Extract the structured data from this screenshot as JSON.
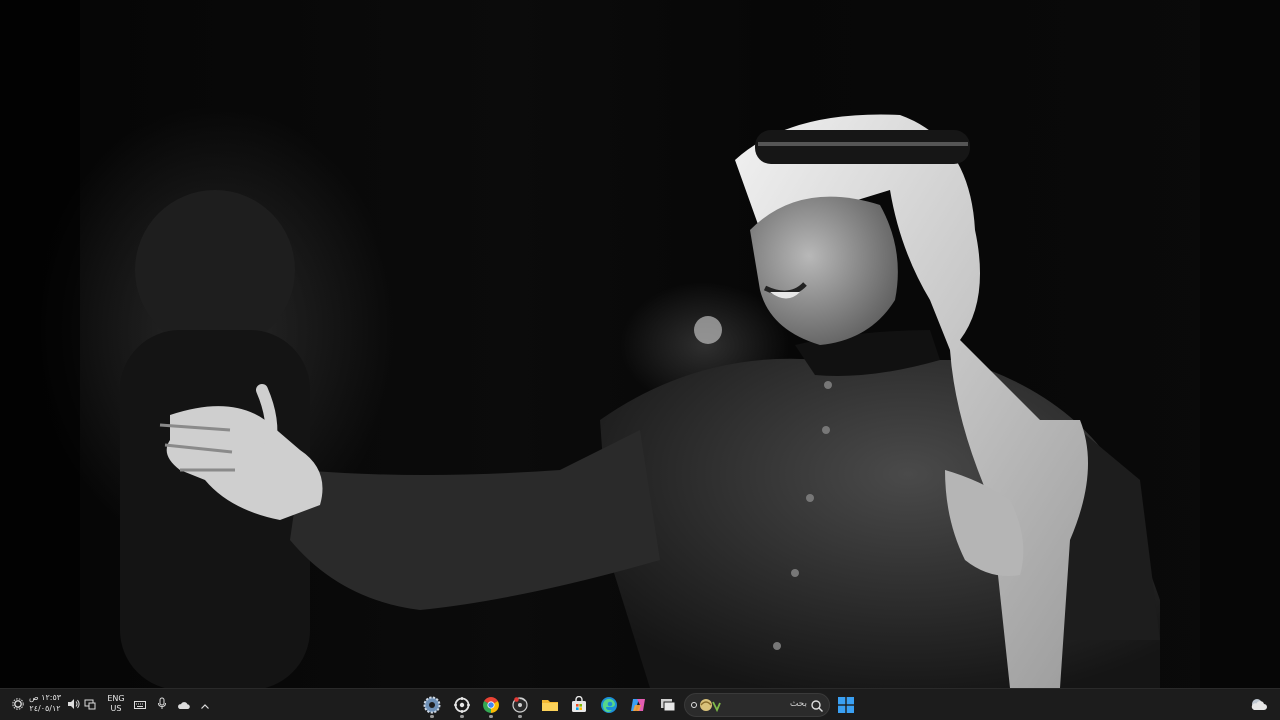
{
  "taskbar": {
    "clock": {
      "time": "١٢:٥٣ ص",
      "date": "٢٤/٠٥/١٢"
    },
    "language": {
      "line1": "ENG",
      "line2": "US"
    },
    "search": {
      "placeholder": "بحث"
    },
    "pinned_apps": [
      {
        "name": "settings",
        "running": true
      },
      {
        "name": "steam",
        "running": true
      },
      {
        "name": "chrome",
        "running": true
      },
      {
        "name": "obs-recorder",
        "running": true
      },
      {
        "name": "file-explorer",
        "running": false
      },
      {
        "name": "microsoft-store",
        "running": false
      },
      {
        "name": "edge",
        "running": false
      },
      {
        "name": "copilot",
        "running": false
      },
      {
        "name": "task-view",
        "running": false
      }
    ],
    "tray_icons": [
      "settings-gear",
      "network",
      "volume",
      "keyboard",
      "microphone",
      "onedrive",
      "show-hidden-icons"
    ],
    "colors": {
      "background": "#1c1c1c",
      "accent": "#3aa0f3"
    }
  }
}
